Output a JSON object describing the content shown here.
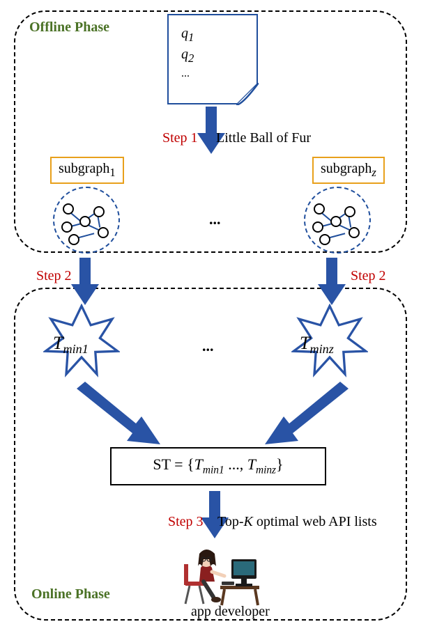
{
  "phases": {
    "offline": "Offline Phase",
    "online": "Online Phase"
  },
  "queries": {
    "q1": "q",
    "q1sub": "1",
    "q2": "q",
    "q2sub": "2",
    "dots": "..."
  },
  "subgraph_labels": {
    "sg1": "subgraph",
    "sg1sub": "1",
    "sgz": "subgraph",
    "sgzsub": "z"
  },
  "steps": {
    "s1": "Step 1",
    "s2": "Step 2",
    "s3": "Step 3"
  },
  "captions": {
    "step1": "Little Ball of Fur",
    "step3_prefix": "Top-",
    "step3_K": "K",
    "step3_suffix": " optimal web API lists"
  },
  "stars": {
    "t": "T",
    "min1": "min1",
    "minz": "minz"
  },
  "st": {
    "prefix": "ST = {",
    "t": "T",
    "min1": "min1",
    "mid": "   ..., ",
    "minz": "minz",
    "suffix": "}"
  },
  "ellipsis": "...",
  "developer": "app developer"
}
